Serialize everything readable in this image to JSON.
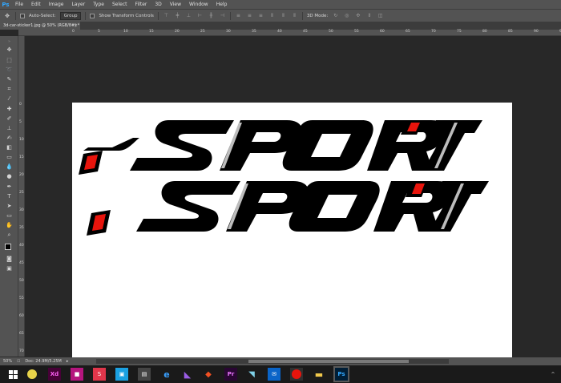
{
  "app": {
    "logo": "Ps",
    "menu": [
      "File",
      "Edit",
      "Image",
      "Layer",
      "Type",
      "Select",
      "Filter",
      "3D",
      "View",
      "Window",
      "Help"
    ]
  },
  "options": {
    "auto_select_label": "Auto-Select:",
    "auto_select_value": "Group",
    "transform_label": "Show Transform Controls",
    "mode_label": "3D Mode:"
  },
  "document": {
    "tab_title": "3d-car-sticker1.jpg @ 50% (RGB/8#)",
    "tab_modified": "*",
    "close": "×"
  },
  "ruler": {
    "top": [
      "0",
      "5",
      "10",
      "15",
      "20",
      "25",
      "30",
      "35",
      "40",
      "45",
      "50",
      "55",
      "60",
      "65",
      "70",
      "75",
      "80",
      "85",
      "90",
      "95"
    ],
    "left": [
      "0",
      "5",
      "10",
      "15",
      "20",
      "25",
      "30",
      "35",
      "40",
      "45",
      "50",
      "55",
      "60",
      "65",
      "70",
      "75"
    ]
  },
  "canvas": {
    "word": "SPORT"
  },
  "status": {
    "zoom": "50%",
    "doc_size": "Doc: 24.9M/5.25M"
  },
  "colors": {
    "chrome": "#535353",
    "dark": "#282828",
    "accent_red": "#e8140c",
    "ps_blue": "#31a8ff"
  },
  "taskbar": {
    "icons": [
      "windows-start",
      "media",
      "xd",
      "indesign",
      "sketch",
      "store-a",
      "photos",
      "edge",
      "visual-studio",
      "git",
      "premiere",
      "app-b",
      "outlook",
      "record",
      "explorer",
      "photoshop"
    ]
  }
}
